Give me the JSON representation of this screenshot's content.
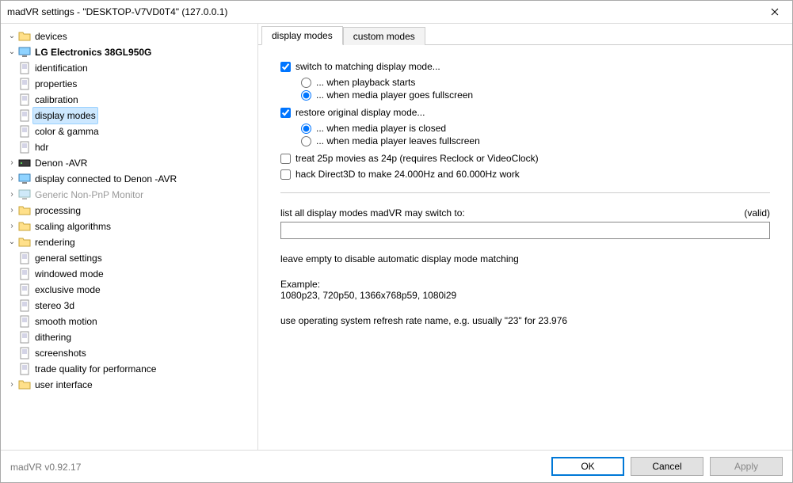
{
  "window": {
    "title": "madVR settings - \"DESKTOP-V7VD0T4\" (127.0.0.1)"
  },
  "version": "madVR v0.92.17",
  "tree": {
    "devices": "devices",
    "lg": "LG Electronics 38GL950G",
    "ident": "identification",
    "props": "properties",
    "calib": "calibration",
    "disp": "display modes",
    "cg": "color & gamma",
    "hdr": "hdr",
    "denon": "Denon -AVR",
    "connDenon": "display connected to Denon -AVR",
    "generic": "Generic Non-PnP Monitor",
    "processing": "processing",
    "scaling": "scaling algorithms",
    "rendering": "rendering",
    "gen": "general settings",
    "win": "windowed mode",
    "excl": "exclusive mode",
    "stereo": "stereo 3d",
    "smooth": "smooth motion",
    "dith": "dithering",
    "shots": "screenshots",
    "tqp": "trade quality for performance",
    "ui": "user interface"
  },
  "tabs": {
    "display": "display modes",
    "custom": "custom modes"
  },
  "pane": {
    "switch": "switch to matching display mode...",
    "opt_start": "... when playback starts",
    "opt_full": "... when media player goes fullscreen",
    "restore": "restore original display mode...",
    "opt_closed": "... when media player is closed",
    "opt_leaves": "... when media player leaves fullscreen",
    "treat25": "treat 25p movies as 24p  (requires Reclock or VideoClock)",
    "hack": "hack Direct3D to make 24.000Hz and 60.000Hz work",
    "listlabel": "list all display modes madVR may switch to:",
    "valid": "(valid)",
    "textvalue": "",
    "leave": "leave empty to disable automatic display mode matching",
    "example": "Example:",
    "examplevals": "1080p23, 720p50, 1366x768p59, 1080i29",
    "usenote": "use operating system refresh rate name, e.g. usually \"23\" for 23.976"
  },
  "buttons": {
    "ok": "OK",
    "cancel": "Cancel",
    "apply": "Apply"
  }
}
